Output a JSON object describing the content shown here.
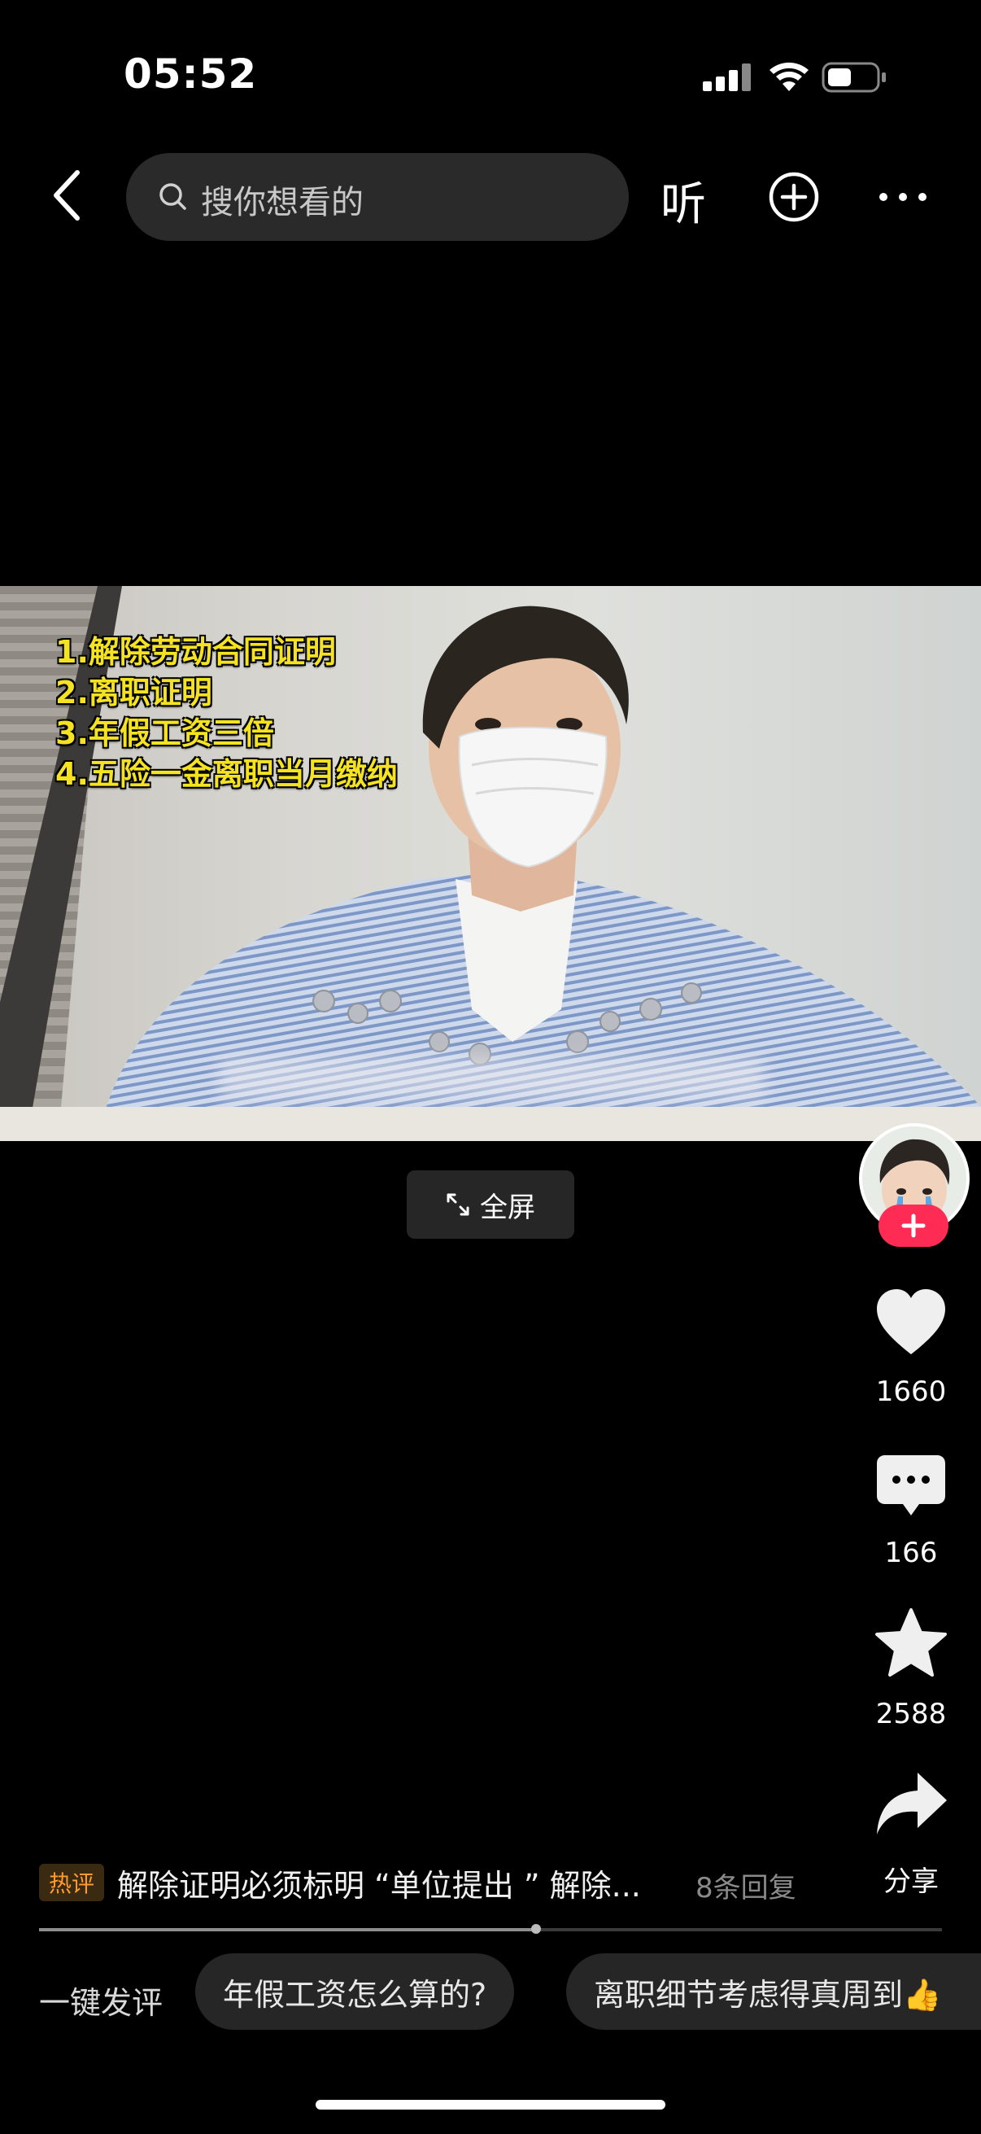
{
  "status_bar": {
    "time": "05:52"
  },
  "top_bar": {
    "search_placeholder": "搜你想看的",
    "listen_label": "听"
  },
  "video": {
    "overlay_lines": [
      "1.解除劳动合同证明",
      "2.离职证明",
      "3.年假工资三倍",
      "4.五险一金离职当月缴纳"
    ],
    "fullscreen_label": "全屏"
  },
  "actions": {
    "likes": "1660",
    "comments": "166",
    "favorites": "2588",
    "share_label": "分享"
  },
  "hot_comment": {
    "badge": "热评",
    "text": "解除证明必须标明 “单位提出 ” 解除...",
    "replies": "8条回复"
  },
  "progress": {
    "fraction": 0.55
  },
  "quick_comments": {
    "label": "一键发评",
    "chips": [
      "年假工资怎么算的?",
      "离职细节考虑得真周到👍"
    ]
  },
  "colors": {
    "accent_red": "#fe2c55",
    "overlay_yellow": "#f5e321",
    "hot_orange": "#ff9b2e"
  },
  "icons": [
    "back-icon",
    "search-icon",
    "add-icon",
    "more-icon",
    "expand-icon",
    "plus-icon",
    "heart-icon",
    "comment-icon",
    "star-icon",
    "share-icon"
  ]
}
